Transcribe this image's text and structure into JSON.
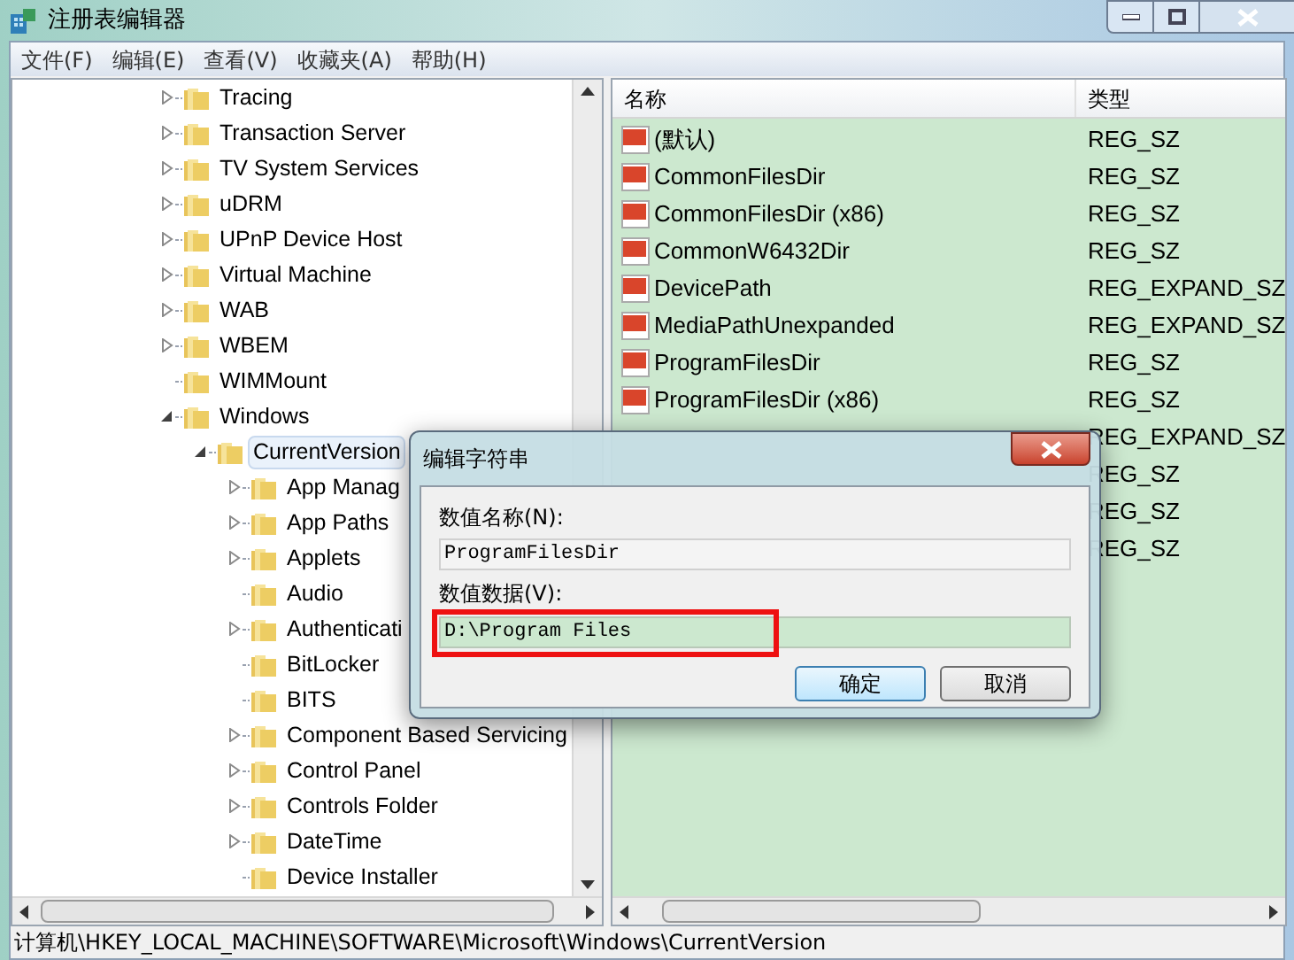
{
  "window": {
    "title": "注册表编辑器"
  },
  "menu": [
    "文件(F)",
    "编辑(E)",
    "查看(V)",
    "收藏夹(A)",
    "帮助(H)"
  ],
  "tree": [
    {
      "label": "Tracing",
      "expanded": false,
      "selected": false
    },
    {
      "label": "Transaction Server",
      "expanded": false,
      "selected": false
    },
    {
      "label": "TV System Services",
      "expanded": false,
      "selected": false
    },
    {
      "label": "uDRM",
      "expanded": false,
      "selected": false
    },
    {
      "label": "UPnP Device Host",
      "expanded": false,
      "selected": false
    },
    {
      "label": "Virtual Machine",
      "expanded": false,
      "selected": false
    },
    {
      "label": "WAB",
      "expanded": false,
      "selected": false
    },
    {
      "label": "WBEM",
      "expanded": false,
      "selected": false
    },
    {
      "label": "WIMMount",
      "selected": false
    },
    {
      "label": "Windows",
      "expanded": true,
      "selected": false,
      "children": [
        {
          "label": "CurrentVersion",
          "expanded": true,
          "selected": true,
          "children": [
            {
              "label": "App Manag",
              "expanded": false,
              "selected": false
            },
            {
              "label": "App Paths",
              "expanded": false,
              "selected": false
            },
            {
              "label": "Applets",
              "expanded": false,
              "selected": false
            },
            {
              "label": "Audio",
              "selected": false
            },
            {
              "label": "Authenticati",
              "expanded": false,
              "selected": false
            },
            {
              "label": "BitLocker",
              "selected": false
            },
            {
              "label": "BITS",
              "selected": false
            },
            {
              "label": "Component Based Servicing",
              "expanded": false,
              "selected": false
            },
            {
              "label": "Control Panel",
              "expanded": false,
              "selected": false
            },
            {
              "label": "Controls Folder",
              "expanded": false,
              "selected": false
            },
            {
              "label": "DateTime",
              "expanded": false,
              "selected": false
            },
            {
              "label": "Device Installer",
              "selected": false
            }
          ]
        }
      ]
    }
  ],
  "values": {
    "columns": [
      "名称",
      "类型"
    ],
    "rows": [
      {
        "name": "(默认)",
        "type": "REG_SZ"
      },
      {
        "name": "CommonFilesDir",
        "type": "REG_SZ"
      },
      {
        "name": "CommonFilesDir (x86)",
        "type": "REG_SZ"
      },
      {
        "name": "CommonW6432Dir",
        "type": "REG_SZ"
      },
      {
        "name": "DevicePath",
        "type": "REG_EXPAND_SZ"
      },
      {
        "name": "MediaPathUnexpanded",
        "type": "REG_EXPAND_SZ"
      },
      {
        "name": "ProgramFilesDir",
        "type": "REG_SZ"
      },
      {
        "name": "ProgramFilesDir (x86)",
        "type": "REG_SZ"
      },
      {
        "type": "REG_EXPAND_SZ"
      },
      {
        "type": "REG_SZ"
      },
      {
        "type": "REG_SZ"
      },
      {
        "type": "REG_SZ"
      }
    ]
  },
  "status_bar": "计算机\\HKEY_LOCAL_MACHINE\\SOFTWARE\\Microsoft\\Windows\\CurrentVersion",
  "dialog": {
    "title": "编辑字符串",
    "name_label": "数值名称(N):",
    "name_value": "ProgramFilesDir",
    "data_label": "数值数据(V):",
    "data_value": "D:\\Program Files",
    "buttons": [
      {
        "label": "确定",
        "default": true
      },
      {
        "label": "取消",
        "default": false
      }
    ]
  }
}
